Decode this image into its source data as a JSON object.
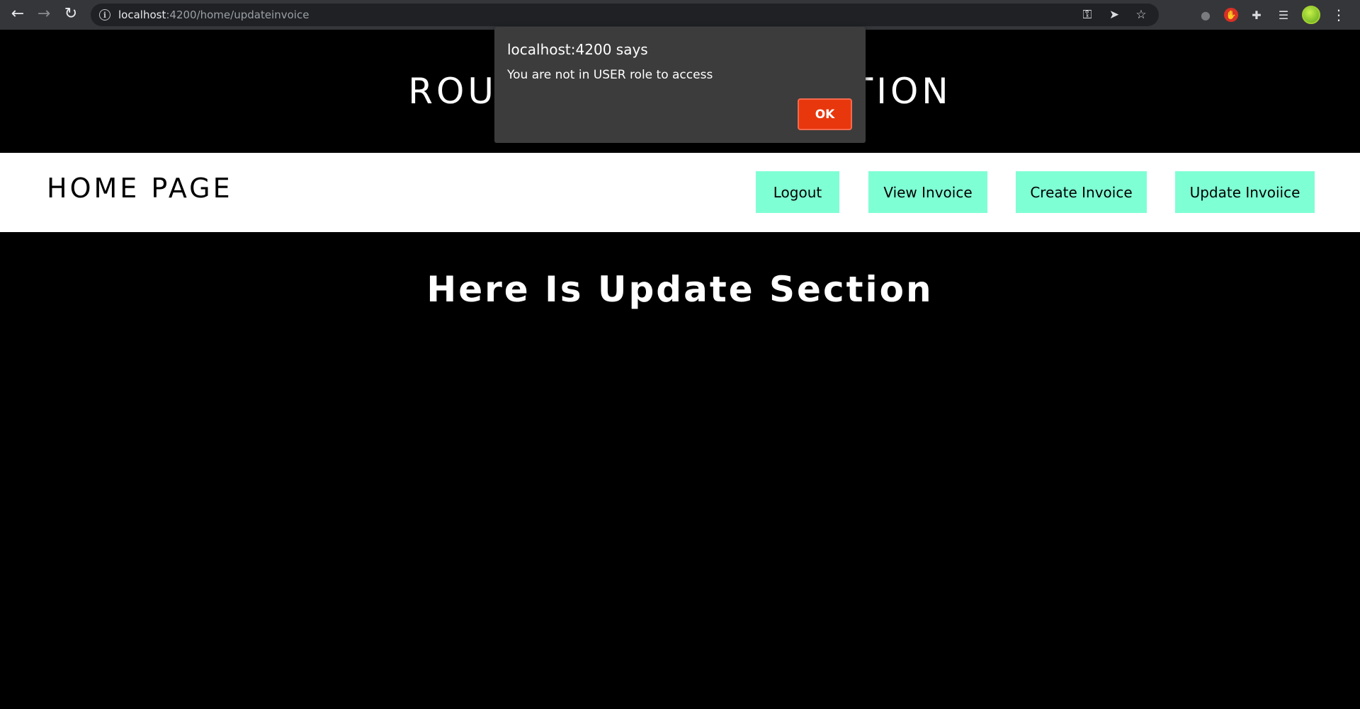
{
  "browser": {
    "url_host": "localhost",
    "url_rest": ":4200/home/updateinvoice"
  },
  "app": {
    "title": "ROUTING AUTHORIZATION",
    "brand": "HOME PAGE",
    "nav_buttons": {
      "logout": "Logout",
      "view": "View Invoice",
      "create": "Create Invoice",
      "update": "Update Invoiice"
    },
    "section_title": "Here Is Update Section",
    "nav_button_color": "#7fffd4"
  },
  "dialog": {
    "title": "localhost:4200 says",
    "message": "You are not in USER role to access",
    "ok_label": "OK",
    "ok_color": "#e8370d"
  }
}
